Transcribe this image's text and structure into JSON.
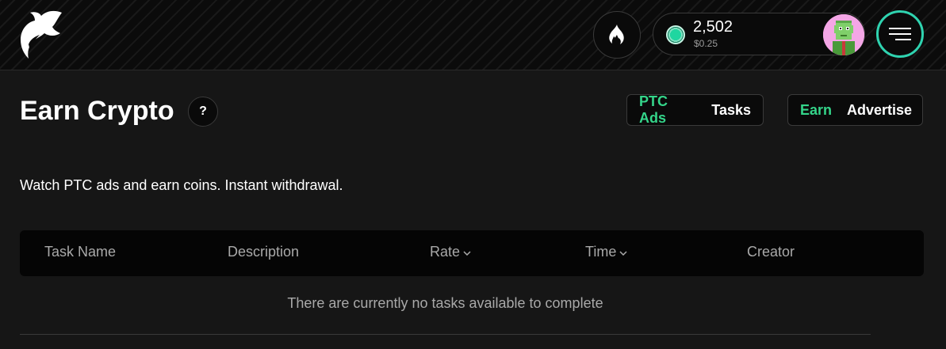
{
  "header": {
    "balance": {
      "amount": "2,502",
      "usd": "$0.25"
    },
    "icons": {
      "logo": "logo-icon",
      "fire": "fire-icon",
      "coin": "coin-icon",
      "menu": "menu-icon"
    },
    "colors": {
      "accent_green": "#34d58a",
      "menu_ring": "#2fd3b0",
      "avatar_bg": "#f4a6e6"
    }
  },
  "page": {
    "title": "Earn Crypto",
    "help_label": "?",
    "subtitle": "Watch PTC ads and earn coins. Instant withdrawal."
  },
  "tabs_type": [
    {
      "label": "PTC Ads",
      "active": true
    },
    {
      "label": "Tasks",
      "active": false
    }
  ],
  "tabs_mode": [
    {
      "label": "Earn",
      "active": true
    },
    {
      "label": "Advertise",
      "active": false
    }
  ],
  "table": {
    "columns": [
      {
        "label": "Task Name",
        "sortable": false
      },
      {
        "label": "Description",
        "sortable": false
      },
      {
        "label": "Rate",
        "sortable": true
      },
      {
        "label": "Time",
        "sortable": true
      },
      {
        "label": "Creator",
        "sortable": false
      }
    ],
    "empty_message": "There are currently no tasks available to complete"
  }
}
